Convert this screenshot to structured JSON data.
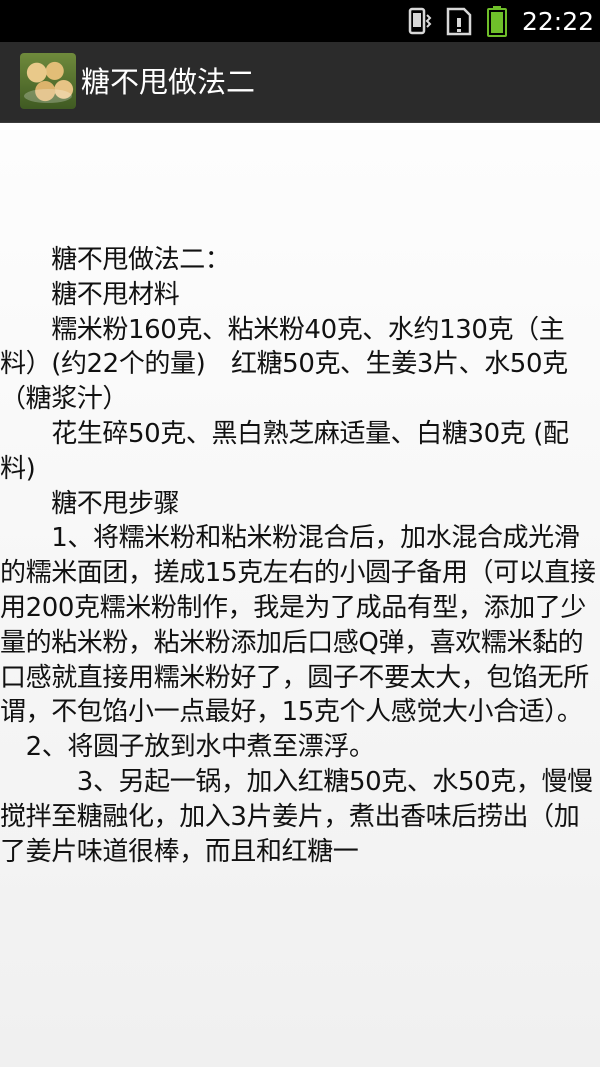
{
  "status_bar": {
    "time": "22:22",
    "icons": [
      "vibrate-icon",
      "sim-card-icon",
      "battery-icon"
    ],
    "battery_color": "#6fbf2a"
  },
  "action_bar": {
    "title": "糖不甩做法二",
    "icon": "dessert-thumbnail-icon",
    "background": "#2b2b2b"
  },
  "article": {
    "text": "　　糖不甩做法二：\n　　糖不甩材料\n　　糯米粉160克、粘米粉40克、水约130克（主料）(约22个的量)　红糖50克、生姜3片、水50克 （糖浆汁）\n　　花生碎50克、黑白熟芝麻适量、白糖30克 (配料)\n　　糖不甩步骤\n　　1、将糯米粉和粘米粉混合后，加水混合成光滑的糯米面团，搓成15克左右的小圆子备用（可以直接用200克糯米粉制作，我是为了成品有型，添加了少量的粘米粉，粘米粉添加后口感Q弹，喜欢糯米黏的口感就直接用糯米粉好了，圆子不要太大，包馅无所谓，不包馅小一点最好，15克个人感觉大小合适）。\n　2、将圆子放到水中煮至漂浮。\n　　　3、另起一锅，加入红糖50克、水50克，慢慢搅拌至糖融化，加入3片姜片，煮出香味后捞出（加了姜片味道很棒，而且和红糖一"
  }
}
